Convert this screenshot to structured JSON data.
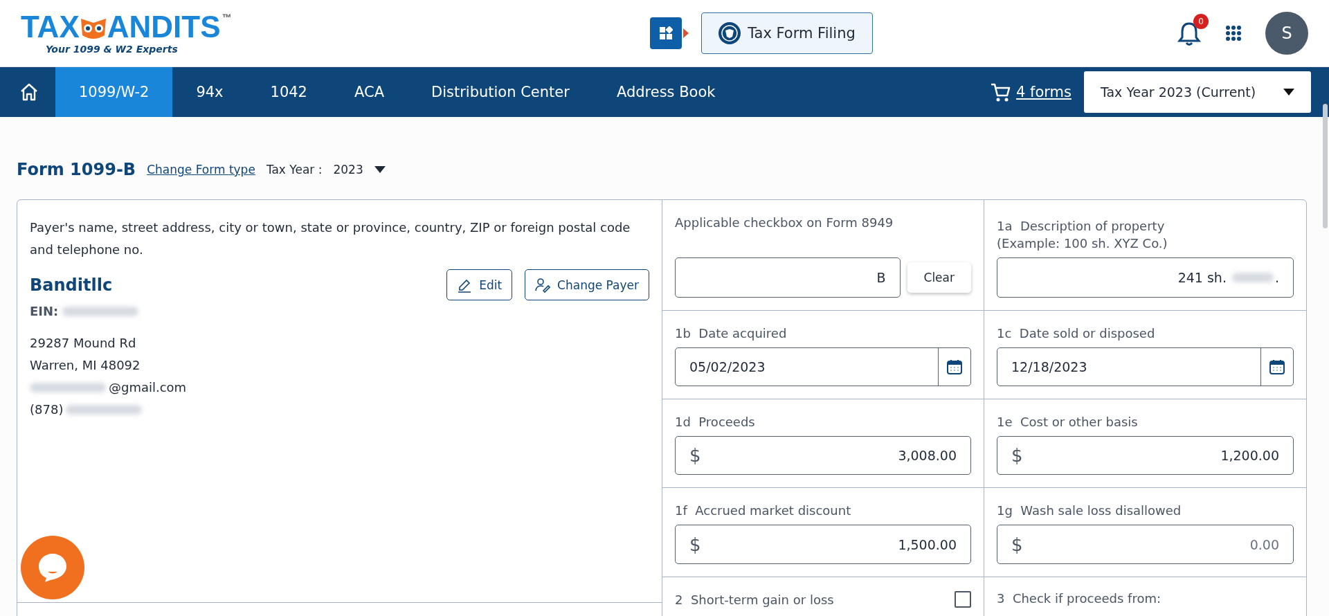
{
  "header": {
    "logo": {
      "part_1": "TAX",
      "part_2": "ANDITS",
      "trademark": "™",
      "tagline": "Your 1099 & W2 Experts"
    },
    "app_button": "Tax Form Filing",
    "notification_count": "0",
    "avatar": "S"
  },
  "nav": {
    "tabs": [
      {
        "label": "1099/W-2",
        "selected": true
      },
      {
        "label": "94x",
        "selected": false
      },
      {
        "label": "1042",
        "selected": false
      },
      {
        "label": "ACA",
        "selected": false
      },
      {
        "label": "Distribution Center",
        "selected": false
      },
      {
        "label": "Address Book",
        "selected": false
      }
    ],
    "cart": "4 forms",
    "tax_year_select": "Tax Year 2023 (Current)"
  },
  "form_header": {
    "title": "Form 1099-B",
    "change_link": "Change Form type",
    "tax_year_label": "Tax Year :",
    "tax_year": "2023"
  },
  "payer": {
    "label": "Payer's name, street address, city or town, state or province, country, ZIP or foreign postal code and telephone no.",
    "name": "Banditllc",
    "ein_label": "EIN:",
    "address": [
      "29287 Mound Rd",
      "Warren, MI 48092"
    ],
    "email": "@gmail.com",
    "phone": "(878)",
    "buttons": [
      "Edit",
      "Change Payer"
    ]
  },
  "boxes": [
    {
      "kind": "code",
      "label": "Applicable checkbox on Form 8949",
      "value": "B",
      "button": "Clear"
    },
    {
      "kind": "text",
      "number": "1a",
      "label": "Description of property",
      "hint": "(Example: 100 sh. XYZ Co.)",
      "value": "241 sh.",
      "value_end": "."
    },
    {
      "kind": "date",
      "number": "1b",
      "label": "Date acquired",
      "value": "05/02/2023"
    },
    {
      "kind": "date",
      "number": "1c",
      "label": "Date sold or disposed",
      "value": "12/18/2023"
    },
    {
      "kind": "amount",
      "number": "1d",
      "label": "Proceeds",
      "currency": "$",
      "value": "3,008.00"
    },
    {
      "kind": "amount",
      "number": "1e",
      "label": "Cost or other basis",
      "currency": "$",
      "value": "1,200.00"
    },
    {
      "kind": "amount",
      "number": "1f",
      "label": "Accrued market discount",
      "currency": "$",
      "value": "1,500.00"
    },
    {
      "kind": "amount",
      "number": "1g",
      "label": "Wash sale loss disallowed",
      "currency": "$",
      "placeholder": "0.00"
    },
    {
      "kind": "check",
      "number": "2",
      "label": "Short-term gain or loss",
      "checked": false
    },
    {
      "kind": "heading",
      "number": "3",
      "label": "Check if proceeds from:"
    }
  ]
}
